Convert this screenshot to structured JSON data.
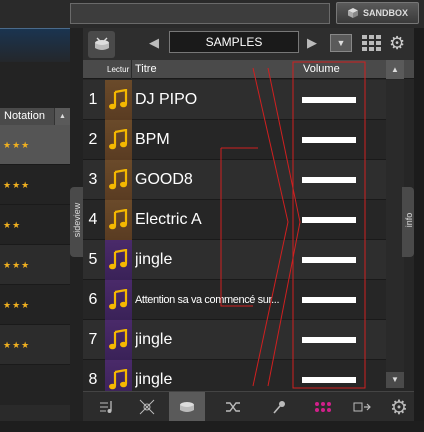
{
  "topbar": {
    "search_value": "",
    "sandbox_label": "SANDBOX"
  },
  "left_panel": {
    "notation_header": "Notation",
    "ratings": [
      "★★★",
      "★★★",
      "★★",
      "★★★",
      "★★★",
      "★★★"
    ],
    "sideview_label": "sideview"
  },
  "browser": {
    "folder_name": "SAMPLES",
    "columns": {
      "lectur": "Lectur",
      "titre": "Titre",
      "volume": "Volume"
    },
    "tracks": [
      {
        "num": "1",
        "title": "DJ PIPO",
        "art": "brown",
        "volume": 1.0
      },
      {
        "num": "2",
        "title": "BPM",
        "art": "brown",
        "volume": 1.0
      },
      {
        "num": "3",
        "title": "GOOD8",
        "art": "brown",
        "volume": 1.0
      },
      {
        "num": "4",
        "title": "Electric A",
        "art": "brown",
        "volume": 1.0
      },
      {
        "num": "5",
        "title": "jingle",
        "art": "purple",
        "volume": 1.0
      },
      {
        "num": "6",
        "title": "Attention sa va commencé sur...",
        "art": "purple",
        "volume": 1.0
      },
      {
        "num": "7",
        "title": "jingle",
        "art": "purple",
        "volume": 1.0
      },
      {
        "num": "8",
        "title": "jingle",
        "art": "purple",
        "volume": 1.0
      }
    ],
    "info_label": "info"
  },
  "colors": {
    "annotation_red": "#d02020",
    "star_gold": "#f0b020",
    "art_brown": "#6a4a2a",
    "art_purple": "#4a2a6a",
    "pads_magenta": "#d0208a"
  },
  "bottom_toolbar": {
    "icons": [
      "music-edit-icon",
      "effects-icon",
      "sampler-drum-icon",
      "shuffle-icon",
      "microphone-icon",
      "pads-icon",
      "record-out-icon",
      "gear-icon"
    ]
  }
}
